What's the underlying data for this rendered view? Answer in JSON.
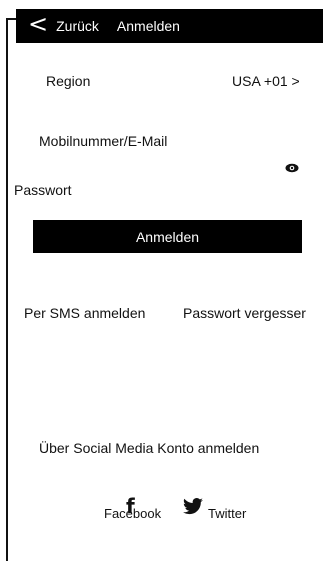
{
  "nav": {
    "back_icon": "<",
    "back_label": "Zurück",
    "title": "Anmelden"
  },
  "form": {
    "region_label": "Region",
    "region_value": "USA +01 >",
    "phone_email_label": "Mobilnummer/E-Mail",
    "password_label": "Passwort",
    "password_icon": "eye-icon",
    "submit_label": "Anmelden"
  },
  "links": {
    "sms_login": "Per SMS anmelden",
    "forgot_password": "Passwort vergesser"
  },
  "social": {
    "heading": "Über Social Media Konto anmelden",
    "facebook_icon": "f",
    "facebook_label": "Facebook",
    "twitter_label": "Twitter"
  },
  "colors": {
    "bar": "#000000",
    "text": "#111111",
    "background": "#ffffff"
  }
}
